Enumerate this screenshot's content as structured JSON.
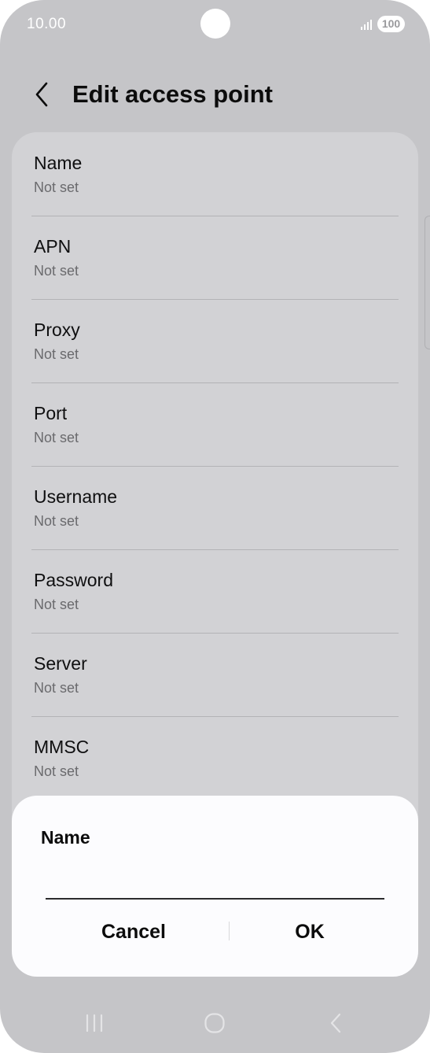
{
  "status_bar": {
    "time": "10.00",
    "battery": "100"
  },
  "header": {
    "title": "Edit access point",
    "back_icon": "chevron-left-icon"
  },
  "settings": [
    {
      "label": "Name",
      "value": "Not set"
    },
    {
      "label": "APN",
      "value": "Not set"
    },
    {
      "label": "Proxy",
      "value": "Not set"
    },
    {
      "label": "Port",
      "value": "Not set"
    },
    {
      "label": "Username",
      "value": "Not set"
    },
    {
      "label": "Password",
      "value": "Not set"
    },
    {
      "label": "Server",
      "value": "Not set"
    },
    {
      "label": "MMSC",
      "value": "Not set"
    }
  ],
  "dialog": {
    "title": "Name",
    "input_value": "",
    "cancel_label": "Cancel",
    "ok_label": "OK"
  },
  "nav_bar": {
    "recents_icon": "recents-icon",
    "home_icon": "home-icon",
    "back_icon": "back-icon"
  },
  "colors": {
    "screen_dim": "#c5c5c8",
    "card": "#d2d2d5",
    "dialog": "#fcfcfe",
    "text": "#0c0c0c",
    "secondary_text": "#6a6a6d"
  }
}
